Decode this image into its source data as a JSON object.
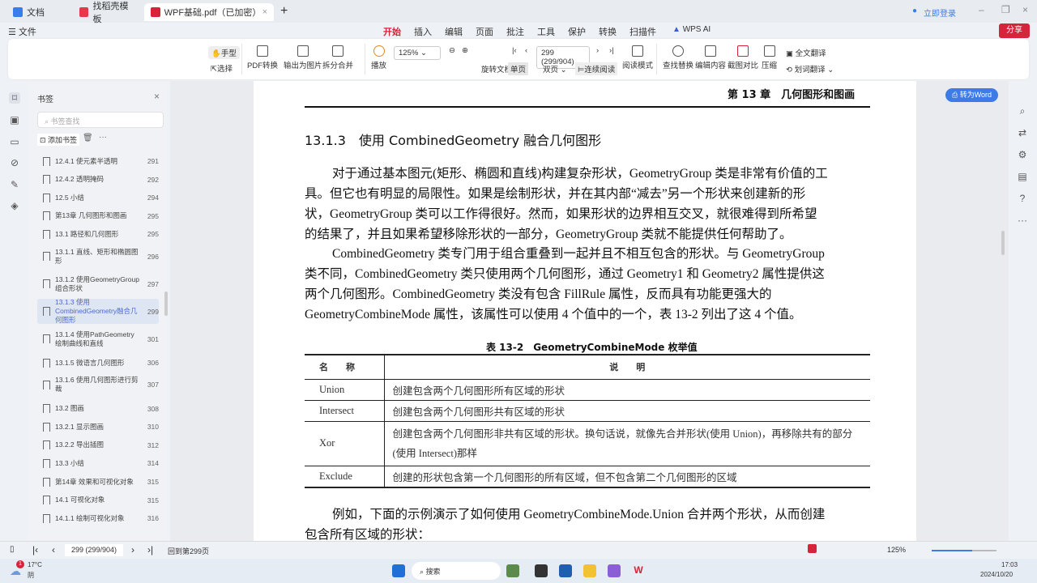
{
  "tabs": [
    {
      "label": "文档",
      "color": "#3b7de8"
    },
    {
      "label": "找稻壳模板",
      "color": "#e6384b"
    },
    {
      "label": "WPF基础.pdf（已加密）",
      "color": "#d6243a",
      "active": true
    }
  ],
  "login": "立即登录",
  "menu": {
    "file": "文件",
    "items": [
      "开始",
      "插入",
      "编辑",
      "页面",
      "批注",
      "工具",
      "保护",
      "转换",
      "扫描件"
    ],
    "ai": "WPS AI",
    "share": "分享"
  },
  "ribbon": {
    "hand": "手型",
    "select": "选择",
    "pdf_convert": "PDF转换",
    "export_image": "输出为图片",
    "split_merge": "拆分合并",
    "play": "播放",
    "zoom": "125%",
    "page_input": "299 (299/904)",
    "rotate": "旋转文档",
    "single": "单页",
    "double": "双页",
    "continuous": "连续阅读",
    "read_mode": "阅读模式",
    "find_replace": "查找替换",
    "edit_content": "编辑内容",
    "compare": "截图对比",
    "compress": "压缩",
    "full_translate": "全文翻译",
    "word_translate": "划词翻译"
  },
  "bookmarks": {
    "title": "书签",
    "search_placeholder": "书签查找",
    "add": "添加书签",
    "items": [
      {
        "t": "12.4.1 使元素半透明",
        "p": "291"
      },
      {
        "t": "12.4.2 透明掩码",
        "p": "292"
      },
      {
        "t": "12.5 小结",
        "p": "294"
      },
      {
        "t": "第13章 几何图形和图画",
        "p": "295"
      },
      {
        "t": "13.1 路径和几何图形",
        "p": "295"
      },
      {
        "t": "13.1.1 直线、矩形和椭圆图形",
        "p": "296"
      },
      {
        "t": "13.1.2 使用GeometryGroup组合形状",
        "p": "297"
      },
      {
        "t": "13.1.3 使用CombinedGeometry融合几何图形",
        "p": "299",
        "sel": true
      },
      {
        "t": "13.1.4 使用PathGeometry绘制曲线和直线",
        "p": "301"
      },
      {
        "t": "13.1.5 微语言几何图形",
        "p": "306"
      },
      {
        "t": "13.1.6 使用几何图形进行剪裁",
        "p": "307"
      },
      {
        "t": "13.2 图画",
        "p": "308"
      },
      {
        "t": "13.2.1 显示图画",
        "p": "310"
      },
      {
        "t": "13.2.2 导出插图",
        "p": "312"
      },
      {
        "t": "13.3 小结",
        "p": "314"
      },
      {
        "t": "第14章 效果和可视化对象",
        "p": "315"
      },
      {
        "t": "14.1 可视化对象",
        "p": "315"
      },
      {
        "t": "14.1.1 绘制可视化对象",
        "p": "316"
      }
    ]
  },
  "doc": {
    "header": "第 13 章　几何图形和图画",
    "heading": "13.1.3　使用 CombinedGeometry 融合几何图形",
    "p1": [
      "对于通过基本图元(矩形、椭圆和直线)构建复杂形状，GeometryGroup 类是非常有价值的工",
      "具。但它也有明显的局限性。如果是绘制形状，并在其内部“减去”另一个形状来创建新的形",
      "状，GeometryGroup 类可以工作得很好。然而，如果形状的边界相互交叉，就很难得到所希望",
      "的结果了，并且如果希望移除形状的一部分，GeometryGroup 类就不能提供任何帮助了。"
    ],
    "p2": [
      "CombinedGeometry 类专门用于组合重叠到一起并且不相互包含的形状。与 GeometryGroup",
      "类不同，CombinedGeometry 类只使用两个几何图形，通过 Geometry1 和 Geometry2 属性提供这",
      "两个几何图形。CombinedGeometry 类没有包含 FillRule 属性，反而具有功能更强大的",
      "GeometryCombineMode 属性，该属性可以使用 4 个值中的一个，表 13-2 列出了这 4 个值。"
    ],
    "table_caption": "表 13-2　GeometryCombineMode 枚举值",
    "table_headers": [
      "名　　称",
      "说　　明"
    ],
    "rows": [
      [
        "Union",
        "创建包含两个几何图形所有区域的形状"
      ],
      [
        "Intersect",
        "创建包含两个几何图形共有区域的形状"
      ],
      [
        "Xor",
        "创建包含两个几何图形非共有区域的形状。换句话说，就像先合并形状(使用 Union)，再移除共有的部分(使用 Intersect)那样"
      ],
      [
        "Exclude",
        "创建的形状包含第一个几何图形的所有区域，但不包含第二个几何图形的区域"
      ]
    ],
    "p3": [
      "例如，下面的示例演示了如何使用 GeometryCombineMode.Union 合并两个形状，从而创建",
      "包含所有区域的形状："
    ]
  },
  "to_word": "转为Word",
  "status": {
    "page": "299 (299/904)",
    "back": "回到第299页",
    "zoom": "125%"
  },
  "taskbar": {
    "weather_temp": "17°C",
    "weather_desc": "阴",
    "weather_badge": "1",
    "search": "搜索",
    "time": "17:03",
    "date": "2024/10/20"
  }
}
